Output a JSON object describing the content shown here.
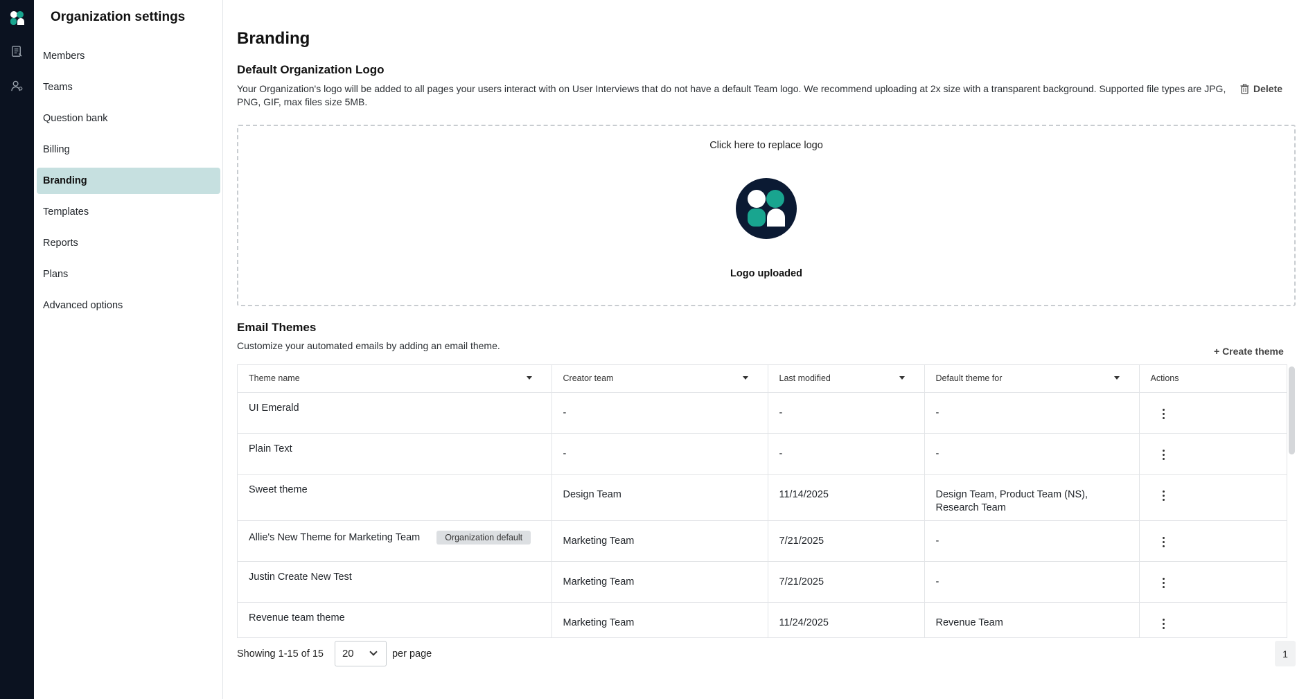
{
  "sidebar": {
    "title": "Organization settings",
    "items": [
      {
        "label": "Members"
      },
      {
        "label": "Teams"
      },
      {
        "label": "Question bank"
      },
      {
        "label": "Billing"
      },
      {
        "label": "Branding"
      },
      {
        "label": "Templates"
      },
      {
        "label": "Reports"
      },
      {
        "label": "Plans"
      },
      {
        "label": "Advanced options"
      }
    ],
    "active_item": "Branding"
  },
  "rail": {
    "icons": [
      "brand-logo-icon",
      "document-icon",
      "user-settings-icon"
    ]
  },
  "main": {
    "title": "Branding",
    "logo_section": {
      "title": "Default Organization Logo",
      "description": "Your Organization's logo will be added to all pages your users interact with on User Interviews that do not have a default Team logo. We recommend uploading at 2x size with a transparent background. Supported file types are JPG, PNG, GIF, max files size 5MB.",
      "delete_label": "Delete",
      "upload_hint": "Click here to replace logo",
      "upload_status": "Logo uploaded"
    },
    "email_themes": {
      "title": "Email Themes",
      "description": "Customize your automated emails by adding an email theme.",
      "create_label": "+ Create theme",
      "columns": [
        "Theme name",
        "Creator team",
        "Last modified",
        "Default theme for",
        "Actions"
      ],
      "rows": [
        {
          "name": "UI Emerald",
          "badge": "",
          "creator": "-",
          "modified": "-",
          "default_for": "-",
          "default_for_2": ""
        },
        {
          "name": "Plain Text",
          "badge": "",
          "creator": "-",
          "modified": "-",
          "default_for": "-",
          "default_for_2": ""
        },
        {
          "name": "Sweet theme",
          "badge": "",
          "creator": "Design Team",
          "modified": "11/14/2025",
          "default_for": "Design Team, Product Team (NS),",
          "default_for_2": "Research Team"
        },
        {
          "name": "Allie's New Theme for Marketing Team",
          "badge": "Organization default",
          "creator": "Marketing Team",
          "modified": "7/21/2025",
          "default_for": "-",
          "default_for_2": ""
        },
        {
          "name": "Justin Create New Test",
          "badge": "",
          "creator": "Marketing Team",
          "modified": "7/21/2025",
          "default_for": "-",
          "default_for_2": ""
        },
        {
          "name": "Revenue team theme",
          "badge": "",
          "creator": "Marketing Team",
          "modified": "11/24/2025",
          "default_for": "Revenue Team",
          "default_for_2": ""
        }
      ]
    },
    "pagination": {
      "showing": "Showing 1-15 of 15",
      "per_page_value": "20",
      "per_page_label": "per page",
      "current_page": "1"
    }
  },
  "colors": {
    "rail_bg": "#0b1220",
    "active_nav_bg": "#c6e0e0",
    "brand_teal": "#138a7a",
    "brand_navy": "#0b1a33"
  }
}
